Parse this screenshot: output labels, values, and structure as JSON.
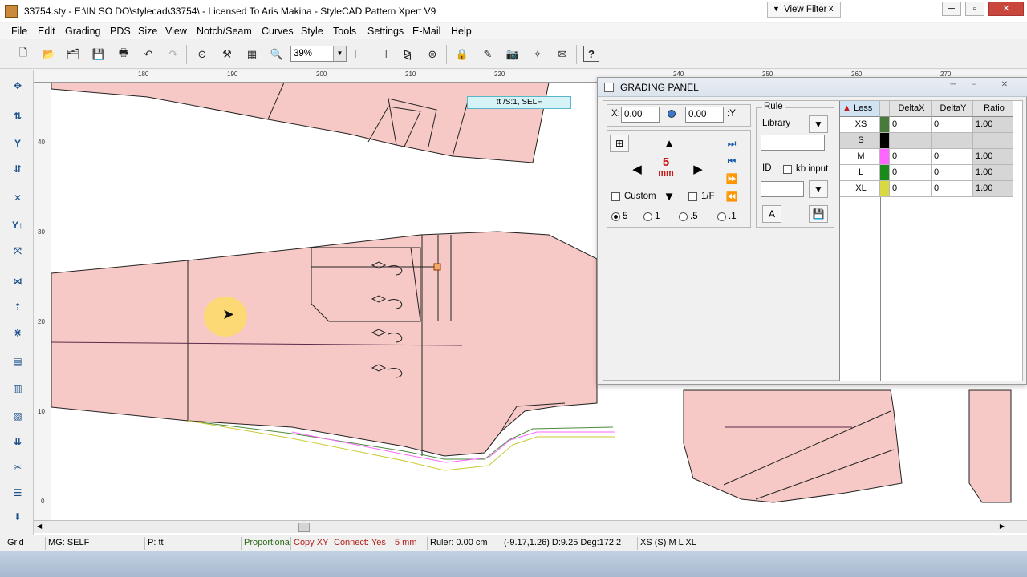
{
  "window": {
    "title": "33754.sty - E:\\IN SO DO\\stylecad\\33754\\ - Licensed To Aris Makina - StyleCAD Pattern Xpert V9",
    "view_filter": "View Filter",
    "close_glyph": "x"
  },
  "menu": [
    "File",
    "Edit",
    "Grading",
    "PDS",
    "Size",
    "View",
    "Notch/Seam",
    "Curves",
    "Style",
    "Tools",
    "Settings",
    "E-Mail",
    "Help"
  ],
  "toolbar": {
    "zoom": "39%"
  },
  "rulers": {
    "top": [
      "180",
      "190",
      "200",
      "210",
      "220",
      "240",
      "250",
      "260",
      "270"
    ],
    "left": [
      "40",
      "30",
      "20",
      "10",
      "0"
    ]
  },
  "canvas": {
    "piece_label": "tt /S:1, SELF",
    "colors": {
      "piece_fill": "#f6c9c6",
      "tag_bg": "#d6f3f8"
    }
  },
  "grading_panel": {
    "title": "GRADING PANEL",
    "x_label": "X:",
    "x_value": "0.00",
    "y_value": "0.00",
    "y_label": ":Y",
    "step_value": "5",
    "step_unit": "mm",
    "custom_label": "Custom",
    "one_f_label": "1/F",
    "steps": [
      "5",
      "1",
      ".5",
      ".1"
    ],
    "rule_label": "Rule",
    "library_label": "Library",
    "id_label": "ID",
    "kb_input_label": "kb input",
    "a_button": "A",
    "table": {
      "less_label": "Less",
      "headers": [
        "DeltaX",
        "DeltaY",
        "Ratio"
      ],
      "rows": [
        {
          "size": "XS",
          "color": "#4a7a3a",
          "dx": "0",
          "dy": "0",
          "ratio": "1.00"
        },
        {
          "size": "S",
          "color": "#000000",
          "dx": "",
          "dy": "",
          "ratio": ""
        },
        {
          "size": "M",
          "color": "#ff66ff",
          "dx": "0",
          "dy": "0",
          "ratio": "1.00"
        },
        {
          "size": "L",
          "color": "#1a8a1a",
          "dx": "0",
          "dy": "0",
          "ratio": "1.00"
        },
        {
          "size": "XL",
          "color": "#d8d840",
          "dx": "0",
          "dy": "0",
          "ratio": "1.00"
        }
      ]
    }
  },
  "status": {
    "grid": "Grid",
    "mg": "MG: SELF",
    "piece": "P: tt",
    "proportional": "Proportional",
    "copyxy": "Copy XY",
    "connect": "Connect: Yes",
    "step": "5 mm",
    "ruler": "Ruler:   0.00 cm",
    "coords": "(-9.17,1.26)  D:9.25  Deg:172.2",
    "sizes": "XS (S) M L XL"
  }
}
